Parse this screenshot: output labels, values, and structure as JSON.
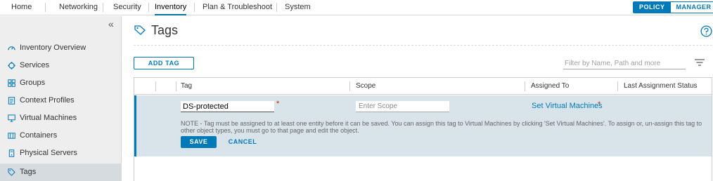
{
  "topnav": {
    "tabs": [
      {
        "label": "Home"
      },
      {
        "label": "Networking"
      },
      {
        "label": "Security"
      },
      {
        "label": "Inventory",
        "active": true
      },
      {
        "label": "Plan & Troubleshoot"
      },
      {
        "label": "System"
      }
    ],
    "mode_policy": "POLICY",
    "mode_manager": "MANAGER"
  },
  "sidebar": {
    "collapse_glyph": "«",
    "items": [
      {
        "label": "Inventory Overview",
        "icon": "dashboard-icon"
      },
      {
        "label": "Services",
        "icon": "services-icon"
      },
      {
        "label": "Groups",
        "icon": "groups-icon"
      },
      {
        "label": "Context Profiles",
        "icon": "context-profile-icon"
      },
      {
        "label": "Virtual Machines",
        "icon": "virtual-machine-icon"
      },
      {
        "label": "Containers",
        "icon": "container-icon"
      },
      {
        "label": "Physical Servers",
        "icon": "server-icon"
      },
      {
        "label": "Tags",
        "icon": "tag-icon",
        "active": true
      }
    ]
  },
  "page": {
    "title": "Tags",
    "add_button": "ADD TAG",
    "filter_placeholder": "Filter by Name, Path and more"
  },
  "grid": {
    "columns": [
      "Tag",
      "Scope",
      "Assigned To",
      "Last Assignment Status"
    ],
    "edit_row": {
      "tag_value": "DS-protected",
      "scope_placeholder": "Enter Scope",
      "required_mark": "*",
      "assigned_link": "Set Virtual Machines",
      "note": "NOTE - Tag must be assigned to at least one entity before it can be saved. You can assign this tag to Virtual Machines by clicking 'Set Virtual Machines'. To assign or, un-assign this tag to other object types, you must go to that page and edit the object.",
      "save": "SAVE",
      "cancel": "CANCEL"
    }
  },
  "colors": {
    "accent": "#0079b8",
    "required": "#c92100",
    "edit_row_bg": "#d9e4ea",
    "sidebar_bg": "#eeeeee"
  }
}
